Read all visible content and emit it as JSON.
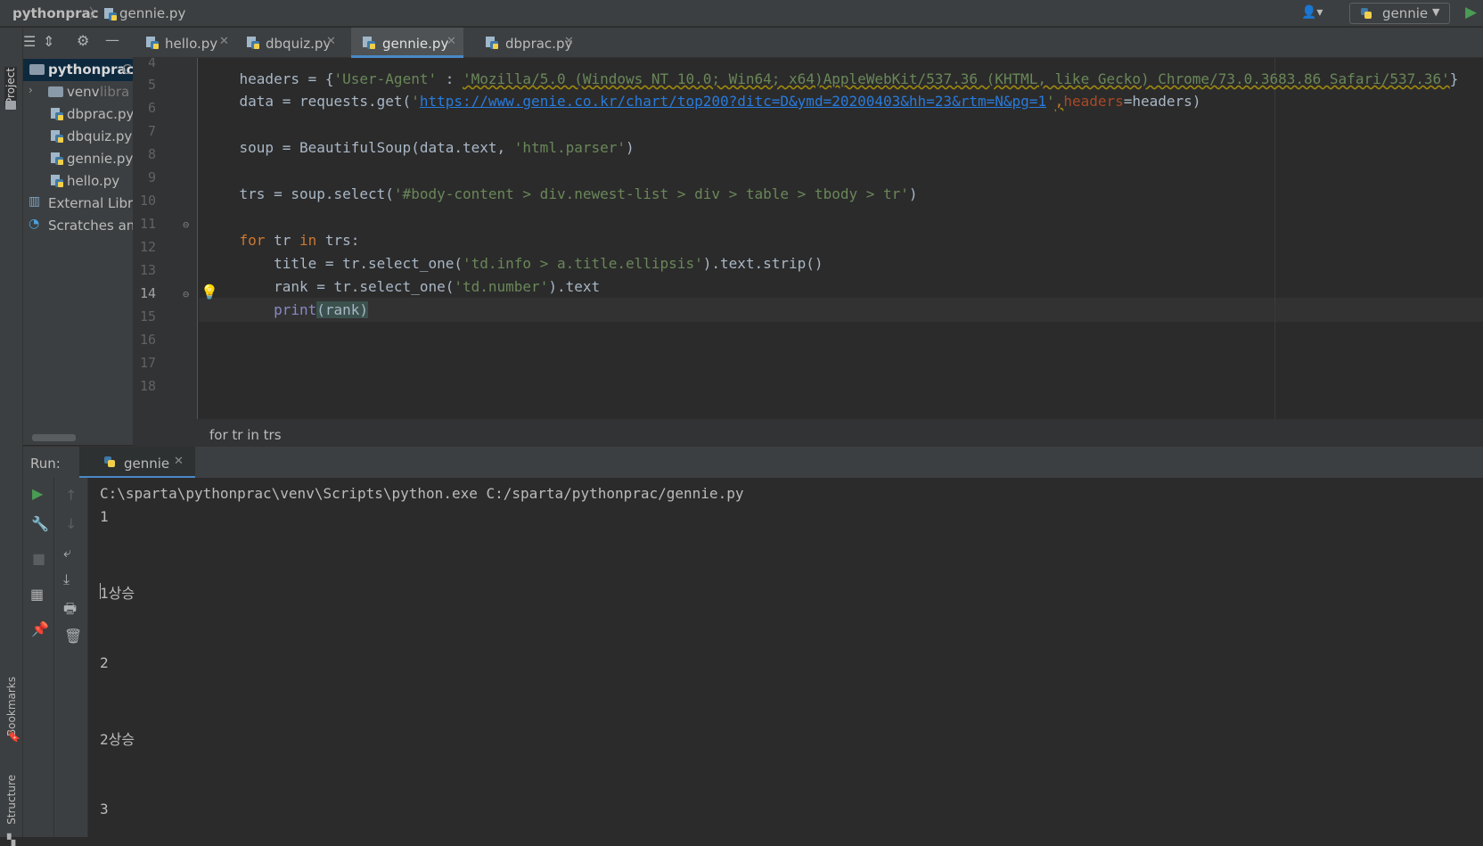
{
  "navbar": {
    "project": "pythonprac",
    "separator": "〉",
    "file": "gennie.py",
    "run_config": "gennie"
  },
  "left_strip": {
    "project_tab": "Project",
    "bookmarks_tab": "Bookmarks",
    "structure_tab": "Structure"
  },
  "project_tree": {
    "root": "pythonprac",
    "root_suffix": "C",
    "venv": "venv",
    "venv_suffix": "libra",
    "files": [
      "dbprac.py",
      "dbquiz.py",
      "gennie.py",
      "hello.py"
    ],
    "external": "External Libra",
    "scratches": "Scratches and"
  },
  "tabs": [
    {
      "label": "hello.py",
      "active": false
    },
    {
      "label": "dbquiz.py",
      "active": false
    },
    {
      "label": "gennie.py",
      "active": true
    },
    {
      "label": "dbprac.py",
      "active": false
    }
  ],
  "editor": {
    "line_numbers": [
      "4",
      "5",
      "6",
      "7",
      "8",
      "9",
      "10",
      "11",
      "12",
      "13",
      "14",
      "15",
      "16",
      "17",
      "18"
    ],
    "current_line": "14",
    "lines": {
      "l4": {
        "a": "headers = {",
        "b": "'User-Agent'",
        "c": " : ",
        "d": "'Mozilla/5.0 (Windows NT 10.0; Win64; x64)AppleWebKit/537.36 (KHTML, like Gecko) Chrome/73.0.3683.86 Safari/537.36'",
        "e": "}"
      },
      "l5": {
        "a": "data = requests.get(",
        "q1": "'",
        "url": "https://www.genie.co.kr/chart/top200?ditc=D&ymd=20200403&hh=23&rtm=N&pg=1",
        "q2": "'",
        "comma": ",",
        "param": "headers",
        "rest": "=headers)"
      },
      "l7": {
        "a": "soup = BeautifulSoup(data.text, ",
        "b": "'html.parser'",
        "c": ")"
      },
      "l9": {
        "a": "trs = soup.select(",
        "b": "'#body-content > div.newest-list > div > table > tbody > tr'",
        "c": ")"
      },
      "l11": {
        "kw1": "for",
        "a": " tr ",
        "kw2": "in",
        "b": " trs:"
      },
      "l12": {
        "a": "    title = tr.select_one(",
        "b": "'td.info > a.title.ellipsis'",
        "c": ").text.strip()"
      },
      "l13": {
        "a": "    rank = tr.select_one(",
        "b": "'td.number'",
        "c": ").text"
      },
      "l14": {
        "indent": "    ",
        "fn": "print",
        "a": "(rank)"
      }
    },
    "breadcrumb": "for tr in trs"
  },
  "run_panel": {
    "label": "Run:",
    "tab": "gennie",
    "output": [
      "C:\\sparta\\pythonprac\\venv\\Scripts\\python.exe C:/sparta/pythonprac/gennie.py",
      "1",
      "1상승",
      "2",
      "2상승",
      "3"
    ]
  },
  "icons": {
    "run": "play-icon",
    "accent": "#4a88c7",
    "run_green": "#499c54"
  }
}
